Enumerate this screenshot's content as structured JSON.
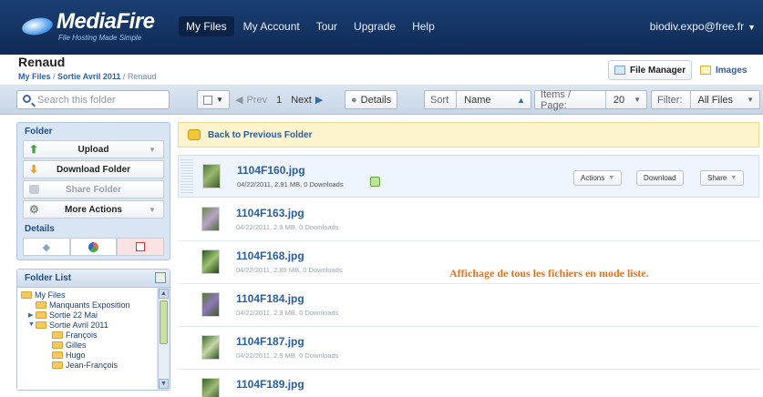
{
  "header": {
    "logo": "MediaFire",
    "tagline": "File Hosting Made Simple",
    "nav": [
      "My Files",
      "My Account",
      "Tour",
      "Upgrade",
      "Help"
    ],
    "user": "biodiv.expo@free.fr"
  },
  "page": {
    "title": "Renaud",
    "breadcrumb": [
      "My Files",
      "Sortie Avril 2011",
      "Renaud"
    ],
    "file_manager_label": "File Manager",
    "images_label": "Images"
  },
  "toolbar": {
    "search_placeholder": "Search this folder",
    "prev": "Prev",
    "page": "1",
    "next": "Next",
    "details": "Details",
    "sort_label": "Sort",
    "sort_value": "Name",
    "items_label": "Items / Page:",
    "items_value": "20",
    "filter_label": "Filter:",
    "filter_value": "All Files"
  },
  "sidebar": {
    "folder_heading": "Folder",
    "upload": "Upload",
    "download_folder": "Download Folder",
    "share_folder": "Share Folder",
    "more_actions": "More Actions",
    "details_heading": "Details"
  },
  "folder_list": {
    "heading": "Folder List",
    "items": [
      "My Files",
      "Manquants Exposition",
      "Sortie 22 Mai",
      "Sortie Avril 2011",
      "François",
      "Gilles",
      "Hugo",
      "Jean-François"
    ]
  },
  "main": {
    "back": "Back to Previous Folder",
    "actions_label": "Actions",
    "download_label": "Download",
    "share_label": "Share",
    "files": [
      {
        "name": "1104F160.jpg",
        "meta": "04/22/2011, 2.91 MB, 0 Downloads"
      },
      {
        "name": "1104F163.jpg",
        "meta": "04/22/2011, 2.9 MB, 0 Downloads"
      },
      {
        "name": "1104F168.jpg",
        "meta": "04/22/2011, 2.89 MB, 0 Downloads"
      },
      {
        "name": "1104F184.jpg",
        "meta": "04/22/2011, 2.9 MB, 0 Downloads"
      },
      {
        "name": "1104F187.jpg",
        "meta": "04/22/2011, 2.9 MB, 0 Downloads"
      },
      {
        "name": "1104F189.jpg",
        "meta": ""
      }
    ],
    "annotation": "Affichage de tous les fichiers en mode liste."
  },
  "colors": {
    "topbar": "#12325f",
    "accent": "#2b5ea0",
    "annotation": "#e8731b"
  }
}
